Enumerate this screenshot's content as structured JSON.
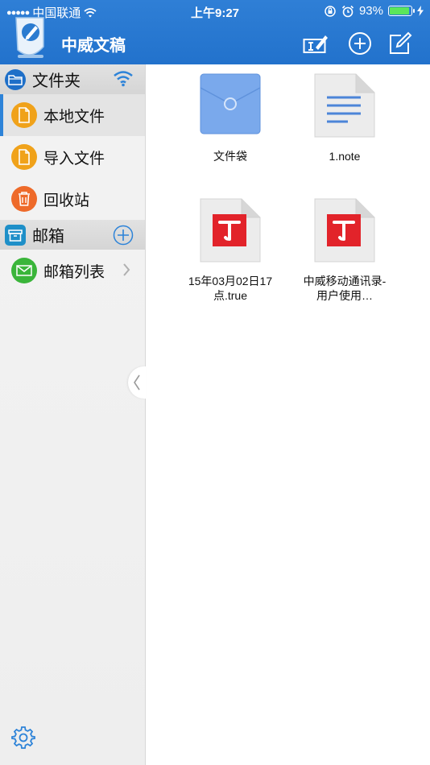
{
  "status": {
    "signal": "●●●●●",
    "carrier": "中国联通",
    "time": "上午9:27",
    "battery": "93%"
  },
  "app": {
    "title": "中威文稿"
  },
  "sidebar": {
    "folders_header": "文件夹",
    "items": [
      {
        "label": "本地文件",
        "color": "#f0a21a"
      },
      {
        "label": "导入文件",
        "color": "#f0a21a"
      },
      {
        "label": "回收站",
        "color": "#ee6a2a"
      }
    ],
    "mail_header": "邮箱",
    "mail_items": [
      {
        "label": "邮箱列表",
        "color": "#3ab53a"
      }
    ]
  },
  "files": [
    {
      "name": "文件袋",
      "kind": "folder-icon"
    },
    {
      "name": "1.note",
      "kind": "note-document-icon"
    },
    {
      "name": "15年03月02日17点.true",
      "kind": "true-document-icon"
    },
    {
      "name": "中威移动通讯录-用户使用…",
      "kind": "true-document-icon"
    }
  ],
  "colors": {
    "header": "#2272cc",
    "accent": "#2d83d8",
    "true_red": "#e2232a"
  }
}
